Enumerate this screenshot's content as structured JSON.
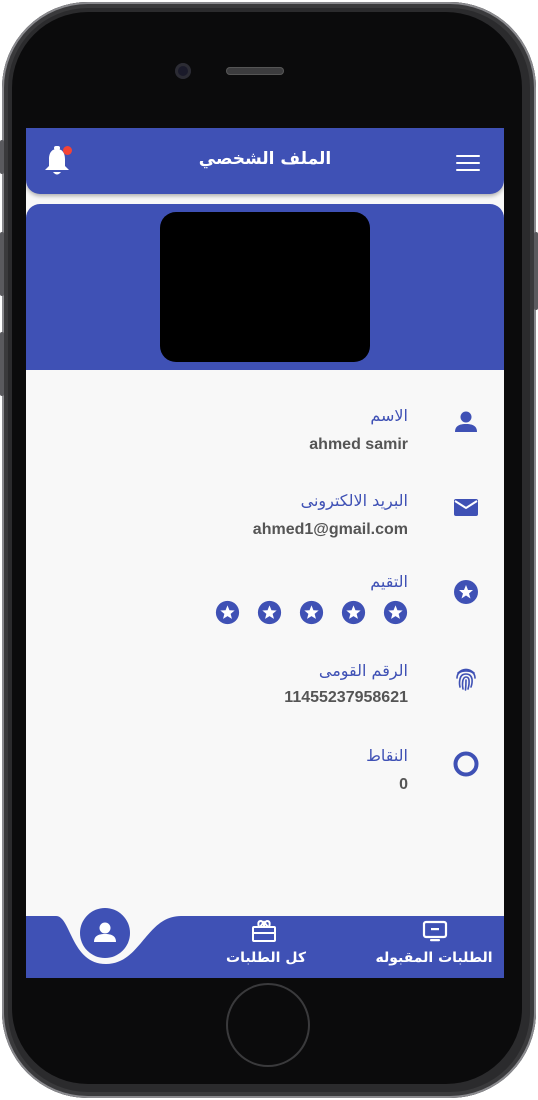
{
  "appbar": {
    "title": "الملف الشخصي"
  },
  "profile": {
    "fields": [
      {
        "label": "الاسم",
        "value": "ahmed samir",
        "icon": "person-icon"
      },
      {
        "label": "البريد الالكترونى",
        "value": "ahmed1@gmail.com",
        "icon": "email-icon"
      },
      {
        "label": "التقيم",
        "rating": 5,
        "icon": "star-circle-icon"
      },
      {
        "label": "الرقم القومى",
        "value": "11455237958621",
        "icon": "fingerprint-icon"
      },
      {
        "label": "النقاط",
        "value": "0",
        "icon": "circle-outline-icon"
      }
    ]
  },
  "bottom_nav": {
    "items": [
      {
        "label": "الطلبات المقبوله",
        "icon": "monitor-icon"
      },
      {
        "label": "كل الطلبات",
        "icon": "gift-box-icon"
      },
      {
        "label": "",
        "icon": "person-icon",
        "active": true
      }
    ]
  },
  "colors": {
    "primary": "#3f51b5",
    "badge": "#f44336",
    "background": "#f8f8f8"
  }
}
